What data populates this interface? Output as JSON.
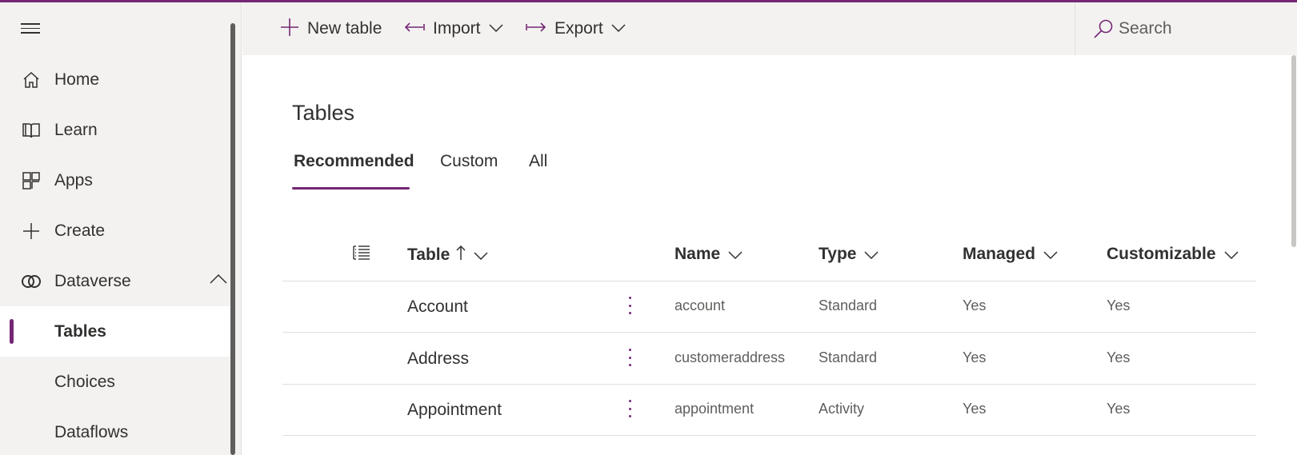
{
  "command_bar": {
    "new_table": "New table",
    "import": "Import",
    "export": "Export",
    "search_placeholder": "Search"
  },
  "sidebar": {
    "items": [
      {
        "label": "Home",
        "icon": "home-icon"
      },
      {
        "label": "Learn",
        "icon": "book-icon"
      },
      {
        "label": "Apps",
        "icon": "apps-icon"
      },
      {
        "label": "Create",
        "icon": "plus-icon"
      },
      {
        "label": "Dataverse",
        "icon": "dataverse-icon",
        "expanded": true
      }
    ],
    "sub_items": [
      {
        "label": "Tables",
        "active": true
      },
      {
        "label": "Choices"
      },
      {
        "label": "Dataflows"
      }
    ]
  },
  "main": {
    "title": "Tables",
    "tabs": [
      {
        "label": "Recommended",
        "selected": true
      },
      {
        "label": "Custom"
      },
      {
        "label": "All"
      }
    ],
    "columns": {
      "table": "Table",
      "name": "Name",
      "type": "Type",
      "managed": "Managed",
      "customizable": "Customizable"
    },
    "rows": [
      {
        "table": "Account",
        "name": "account",
        "type": "Standard",
        "managed": "Yes",
        "customizable": "Yes"
      },
      {
        "table": "Address",
        "name": "customeraddress",
        "type": "Standard",
        "managed": "Yes",
        "customizable": "Yes"
      },
      {
        "table": "Appointment",
        "name": "appointment",
        "type": "Activity",
        "managed": "Yes",
        "customizable": "Yes"
      }
    ]
  },
  "colors": {
    "accent": "#742774",
    "sidebar_bg": "#f3f2f1",
    "text": "#323130",
    "secondary_text": "#605e5c"
  }
}
